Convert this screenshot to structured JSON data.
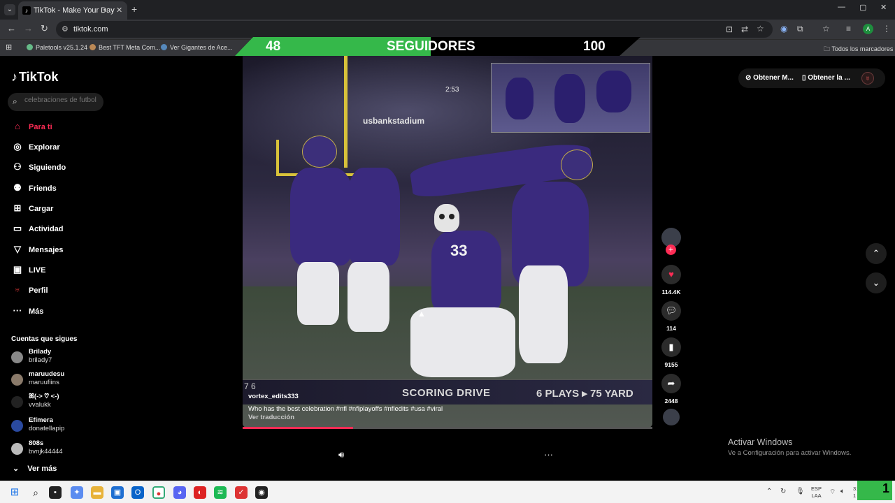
{
  "browser": {
    "tab_title": "TikTok - Make Your Day",
    "tab_icon": "tiktok-icon",
    "url": "tiktok.com",
    "bookmarks": [
      "Paletools v25.1.24",
      "Best TFT Meta Com...",
      "Ver Gigantes de Ace..."
    ],
    "all_bookmarks_label": "Todos los marcadores",
    "profile_initial": "A"
  },
  "overlay": {
    "left_number": "48",
    "label": "SEGUIDORES",
    "right_number": "100",
    "colors": {
      "green": "#35b84a",
      "black": "#000000"
    }
  },
  "tiktok": {
    "logo": "TikTok",
    "search_placeholder": "celebraciones de futbol",
    "nav": [
      {
        "label": "Para ti",
        "icon": "home-icon",
        "active": true
      },
      {
        "label": "Explorar",
        "icon": "compass-icon"
      },
      {
        "label": "Siguiendo",
        "icon": "following-icon"
      },
      {
        "label": "Friends",
        "icon": "friends-icon"
      },
      {
        "label": "Cargar",
        "icon": "upload-icon"
      },
      {
        "label": "Actividad",
        "icon": "activity-icon"
      },
      {
        "label": "Mensajes",
        "icon": "messages-icon"
      },
      {
        "label": "LIVE",
        "icon": "live-icon"
      },
      {
        "label": "Perfil",
        "icon": "profile-icon"
      },
      {
        "label": "Más",
        "icon": "more-icon"
      }
    ],
    "following_heading": "Cuentas que sigues",
    "following": [
      {
        "name": "Brilady",
        "user": "brilady7"
      },
      {
        "name": "maruudesu",
        "user": "maruufiins"
      },
      {
        "name": "ꕤ(-> ♡ <-)",
        "user": "vvalukk"
      },
      {
        "name": "Efímera",
        "user": "donatellapip"
      },
      {
        "name": "808s",
        "user": "bvnjk44444"
      }
    ],
    "see_more": "Ver más",
    "accent": "#fe2c55"
  },
  "video": {
    "stadium_text": "usbankstadium",
    "clock_text": "2:53",
    "jersey_number": "33",
    "scorebar_left": "7 6",
    "scorebar_drive": "SCORING DRIVE",
    "scorebar_plays": "6 PLAYS ▸ 75 YARD",
    "author": "vortex_edits333",
    "caption": "Who has the best celebration #nfl #nflplayoffs #nfledits #usa #viral",
    "translate": "Ver traducción",
    "progress_fraction": 0.27
  },
  "actions": {
    "likes": "114.4K",
    "comments": "114",
    "saves": "9155",
    "shares": "2448"
  },
  "top_right": {
    "get_app": "Obtener M...",
    "get_app2": "Obtener la ..."
  },
  "windows": {
    "activate_title": "Activar Windows",
    "activate_sub": "Ve a Configuración para activar Windows.",
    "lang_top": "ESP",
    "lang_bottom": "LAA",
    "time": "3:4",
    "date": "1 2025",
    "corner_number": "1"
  }
}
